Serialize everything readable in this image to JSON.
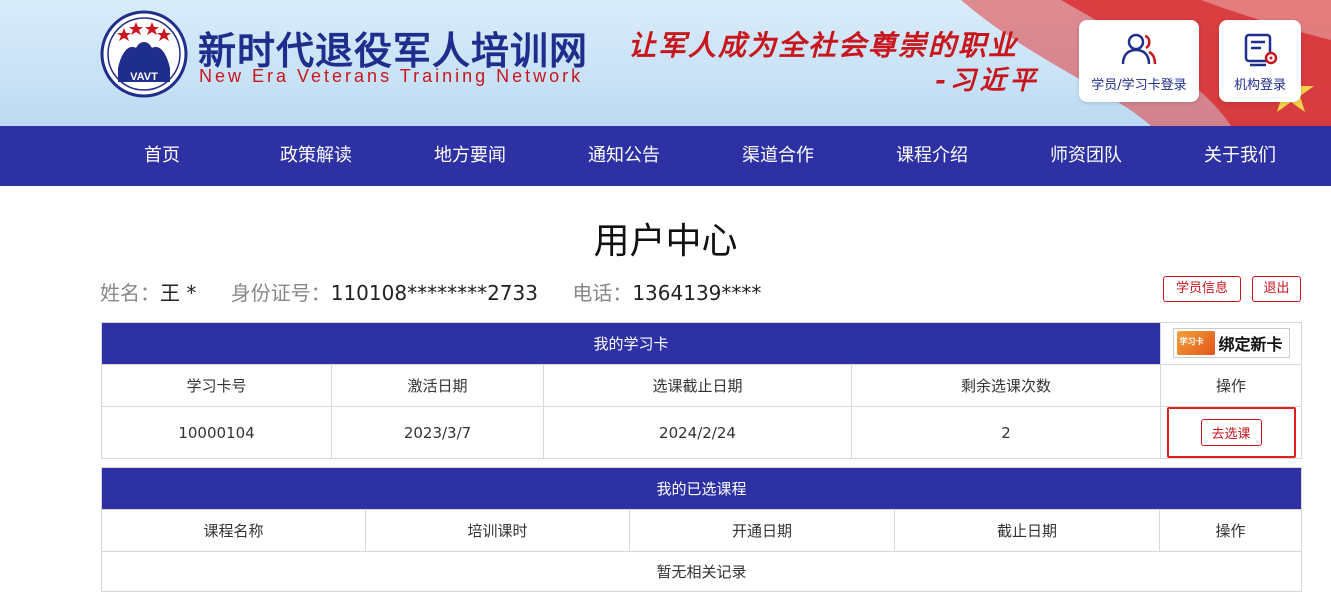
{
  "header": {
    "site_title": "新时代退役军人培训网",
    "site_subtitle": "New Era Veterans Training Network",
    "logo_text": "VAVT",
    "slogan": "让军人成为全社会尊崇的职业",
    "slogan_author": "-习近平",
    "login_student_label": "学员/学习卡登录",
    "login_org_label": "机构登录"
  },
  "nav": {
    "items": [
      "首页",
      "政策解读",
      "地方要闻",
      "通知公告",
      "渠道合作",
      "课程介绍",
      "师资团队",
      "关于我们"
    ]
  },
  "page": {
    "title": "用户中心"
  },
  "user": {
    "name_label": "姓名：",
    "name_value": "王 *",
    "id_label": "身份证号：",
    "id_value": "110108********2733",
    "phone_label": "电话：",
    "phone_value": "1364139****",
    "info_button": "学员信息",
    "logout_button": "退出"
  },
  "card_table": {
    "title": "我的学习卡",
    "bind_card_label": "绑定新卡",
    "bind_card_img_text": "学习卡",
    "columns": [
      "学习卡号",
      "激活日期",
      "选课截止日期",
      "剩余选课次数",
      "操作"
    ],
    "rows": [
      {
        "card_no": "10000104",
        "activate_date": "2023/3/7",
        "deadline": "2024/2/24",
        "remaining": "2",
        "action": "去选课"
      }
    ]
  },
  "course_table": {
    "title": "我的已选课程",
    "columns": [
      "课程名称",
      "培训课时",
      "开通日期",
      "截止日期",
      "操作"
    ],
    "empty_text": "暂无相关记录"
  },
  "colors": {
    "primary_blue": "#2e31a3",
    "brand_red": "#c8161d",
    "title_blue": "#1f2d8c"
  }
}
